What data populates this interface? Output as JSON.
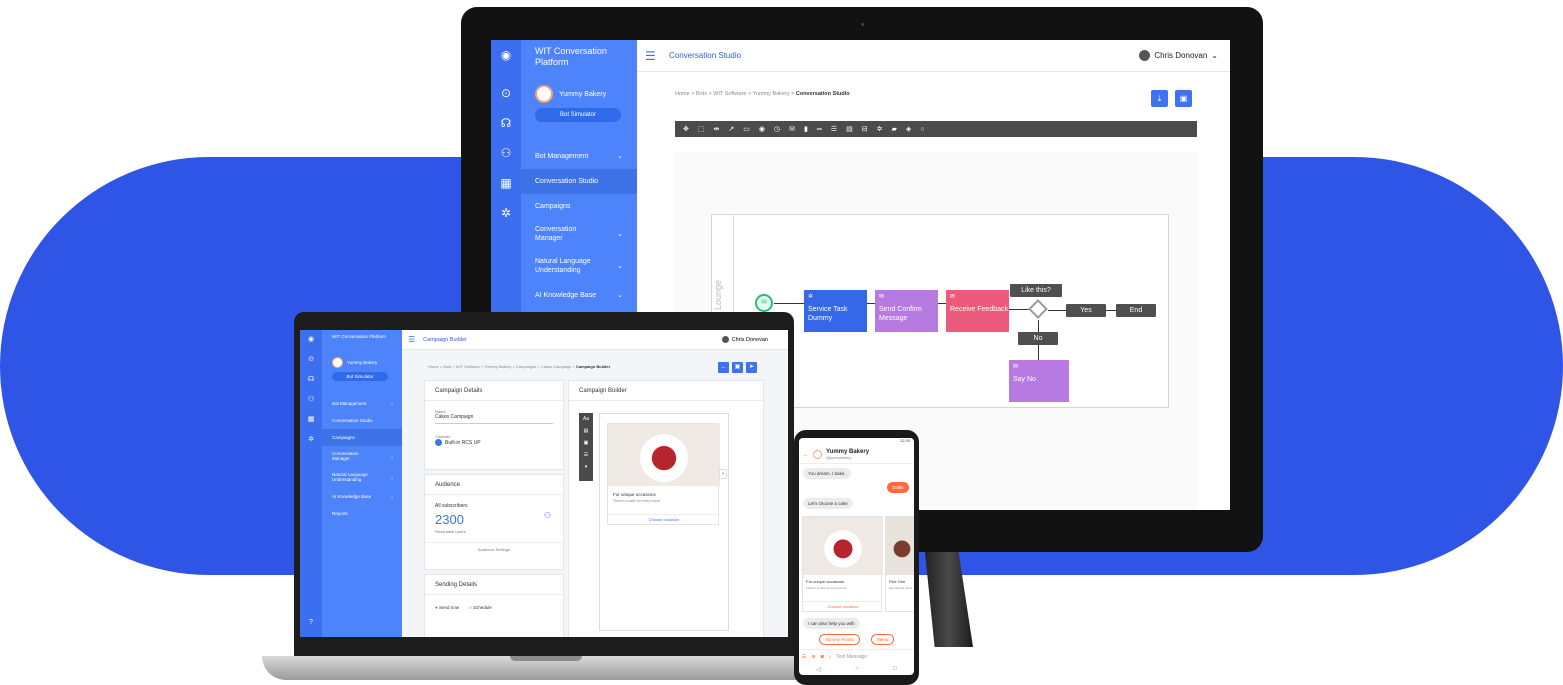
{
  "colors": {
    "brand_blue": "#2f55e6",
    "sidebar": "#4d84fb",
    "accent_orange": "#ff6b3d"
  },
  "monitor": {
    "app_name": "WIT Conversation Platform",
    "bot_name": "Yummy Bakery",
    "bot_simulator": "Bot Simulator",
    "menu": [
      {
        "label": "Bot Management"
      },
      {
        "label": "Conversation Studio"
      },
      {
        "label": "Campaigns"
      },
      {
        "label": "Conversation Manager"
      },
      {
        "label": "Natural Language Understanding"
      },
      {
        "label": "AI Knowledge Base"
      }
    ],
    "page_title": "Conversation Studio",
    "user": "Chris Donovan",
    "breadcrumb": "Home > Bots > WIT Software > Yummy Bakery > ",
    "breadcrumb_current": "Conversation Studio",
    "lane_label": "Lounge",
    "flow": {
      "service_task": "Service Task Dummy",
      "send_confirm": "Send Confirm Message",
      "receive_feedback": "Receive Feedback",
      "gateway_question": "Like this?",
      "yes": "Yes",
      "end": "End",
      "no": "No",
      "say_no": "Say No"
    }
  },
  "laptop": {
    "app_name": "WIT Conversation Platform",
    "bot_name": "Yummy Bakery",
    "bot_simulator": "Bot Simulator",
    "menu": [
      {
        "label": "Bot Management"
      },
      {
        "label": "Conversation Studio"
      },
      {
        "label": "Campaigns"
      },
      {
        "label": "Conversation Manager"
      },
      {
        "label": "Natural Language Understanding"
      },
      {
        "label": "AI Knowledge Base"
      },
      {
        "label": "Reports"
      }
    ],
    "page_title": "Campaign Builder",
    "user": "Chris Donovan",
    "breadcrumb": "Home > Bots > WIT Software > Yummy Bakery > Campaigns > Cakes Campaign > ",
    "breadcrumb_current": "Campaign Builder",
    "details": {
      "header": "Campaign Details",
      "name_label": "Name",
      "name_value": "Cakes Campaign",
      "channel_label": "Channel",
      "channel_value": "Built-in RCS UP"
    },
    "audience": {
      "header": "Audience",
      "all_subscribers": "All subscribers",
      "count": "2300",
      "reachable": "Reachable Users",
      "settings": "Audience Settings"
    },
    "sending": {
      "header": "Sending Details",
      "send_now": "Send now",
      "schedule": "Schedule"
    },
    "builder": {
      "header": "Campaign Builder",
      "card_title": "For unique occasions",
      "card_desc": "There's a cake for every event",
      "card_action": "Choose occasion"
    }
  },
  "phone": {
    "time": "12:30",
    "bot_name": "Yummy Bakery",
    "bot_handle": "@yummybakery",
    "msg1": "You dream. I bake.",
    "order_chip": "Order",
    "msg2": "Let's choose a cake",
    "card_title": "For unique occasions",
    "card_desc": "There's a cake for every event",
    "card2_title": "Pick One",
    "card2_desc": "See the full menu",
    "card_action": "Choose occasion",
    "msg3": "I can also help you with",
    "chip_points": "Yummy Points",
    "chip_menu": "Menu",
    "input_placeholder": "Text Message"
  }
}
